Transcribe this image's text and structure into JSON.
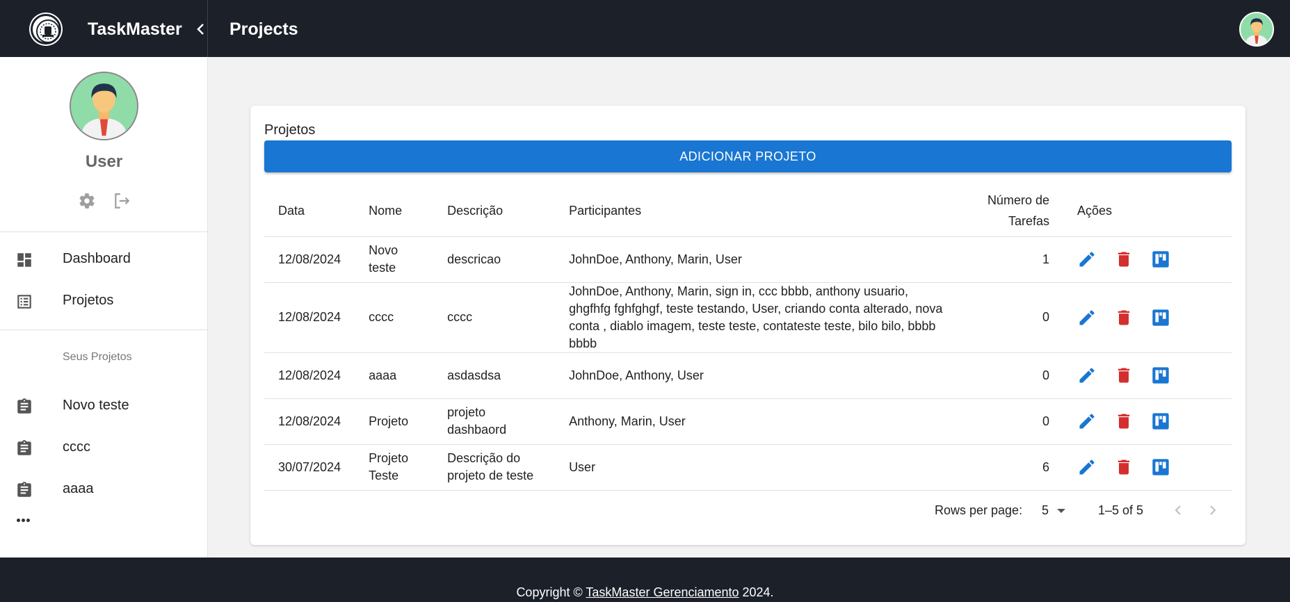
{
  "header": {
    "brand_name": "TaskMaster",
    "page_title": "Projects"
  },
  "sidebar": {
    "user_name": "User",
    "nav": [
      {
        "label": "Dashboard",
        "icon": "dashboard-icon"
      },
      {
        "label": "Projetos",
        "icon": "list-icon"
      }
    ],
    "section_label": "Seus Projetos",
    "projects": [
      {
        "label": "Novo teste",
        "icon": "assignment-icon"
      },
      {
        "label": "cccc",
        "icon": "assignment-icon"
      },
      {
        "label": "aaaa",
        "icon": "assignment-icon"
      }
    ]
  },
  "main": {
    "card_title": "Projetos",
    "add_button_label": "ADICIONAR PROJETO",
    "columns": {
      "data": "Data",
      "nome": "Nome",
      "descricao": "Descrição",
      "participantes": "Participantes",
      "numero_tarefas": "Número de Tarefas",
      "acoes": "Ações"
    },
    "rows": [
      {
        "data": "12/08/2024",
        "nome": "Novo teste",
        "descricao": "descricao",
        "participantes": "JohnDoe, Anthony, Marin, User",
        "tarefas": "1"
      },
      {
        "data": "12/08/2024",
        "nome": "cccc",
        "descricao": "cccc",
        "participantes": "JohnDoe, Anthony, Marin, sign in, ccc bbbb, anthony usuario, ghgfhfg fghfghgf, teste testando, User, criando conta alterado, nova conta , diablo imagem, teste teste, contateste teste, bilo bilo, bbbb bbbb",
        "tarefas": "0"
      },
      {
        "data": "12/08/2024",
        "nome": "aaaa",
        "descricao": "asdasdsa",
        "participantes": "JohnDoe, Anthony, User",
        "tarefas": "0"
      },
      {
        "data": "12/08/2024",
        "nome": "Projeto",
        "descricao": "projeto dashbaord",
        "participantes": "Anthony, Marin, User",
        "tarefas": "0"
      },
      {
        "data": "30/07/2024",
        "nome": "Projeto Teste",
        "descricao": "Descrição do projeto de teste",
        "participantes": "User",
        "tarefas": "6"
      }
    ],
    "pagination": {
      "rows_per_page_label": "Rows per page:",
      "rows_per_page_value": "5",
      "range": "1–5 of 5"
    }
  },
  "footer": {
    "prefix": "Copyright © ",
    "link": "TaskMaster Gerenciamento",
    "suffix": " 2024."
  },
  "colors": {
    "header_bg": "#1b2029",
    "primary": "#1976d2",
    "delete": "#d32f2f"
  }
}
